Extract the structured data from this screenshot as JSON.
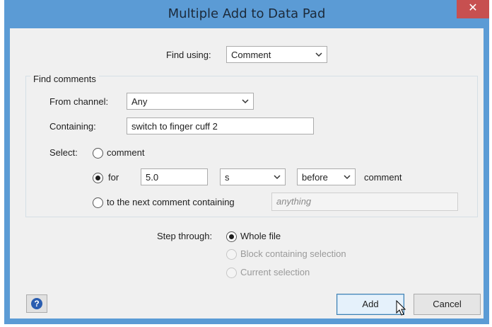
{
  "window": {
    "title": "Multiple Add to Data Pad",
    "close_glyph": "✕"
  },
  "find_using": {
    "label": "Find using:",
    "value": "Comment"
  },
  "find_comments": {
    "group_title": "Find comments",
    "from_channel": {
      "label": "From channel:",
      "value": "Any"
    },
    "containing": {
      "label": "Containing:",
      "value": "switch to finger cuff 2"
    },
    "select": {
      "label": "Select:",
      "opt_comment": "comment",
      "opt_for": "for",
      "for_value": "5.0",
      "units_value": "s",
      "when_value": "before",
      "after_text": "comment",
      "opt_next": "to the next comment containing",
      "next_placeholder": "anything",
      "selected": "for"
    }
  },
  "step_through": {
    "label": "Step through:",
    "options": [
      "Whole file",
      "Block containing selection",
      "Current selection"
    ],
    "selected": "Whole file"
  },
  "buttons": {
    "help": "?",
    "add": "Add",
    "cancel": "Cancel"
  },
  "colors": {
    "titlebar": "#5b9bd5",
    "close": "#c75050",
    "client": "#f0f0f0"
  }
}
